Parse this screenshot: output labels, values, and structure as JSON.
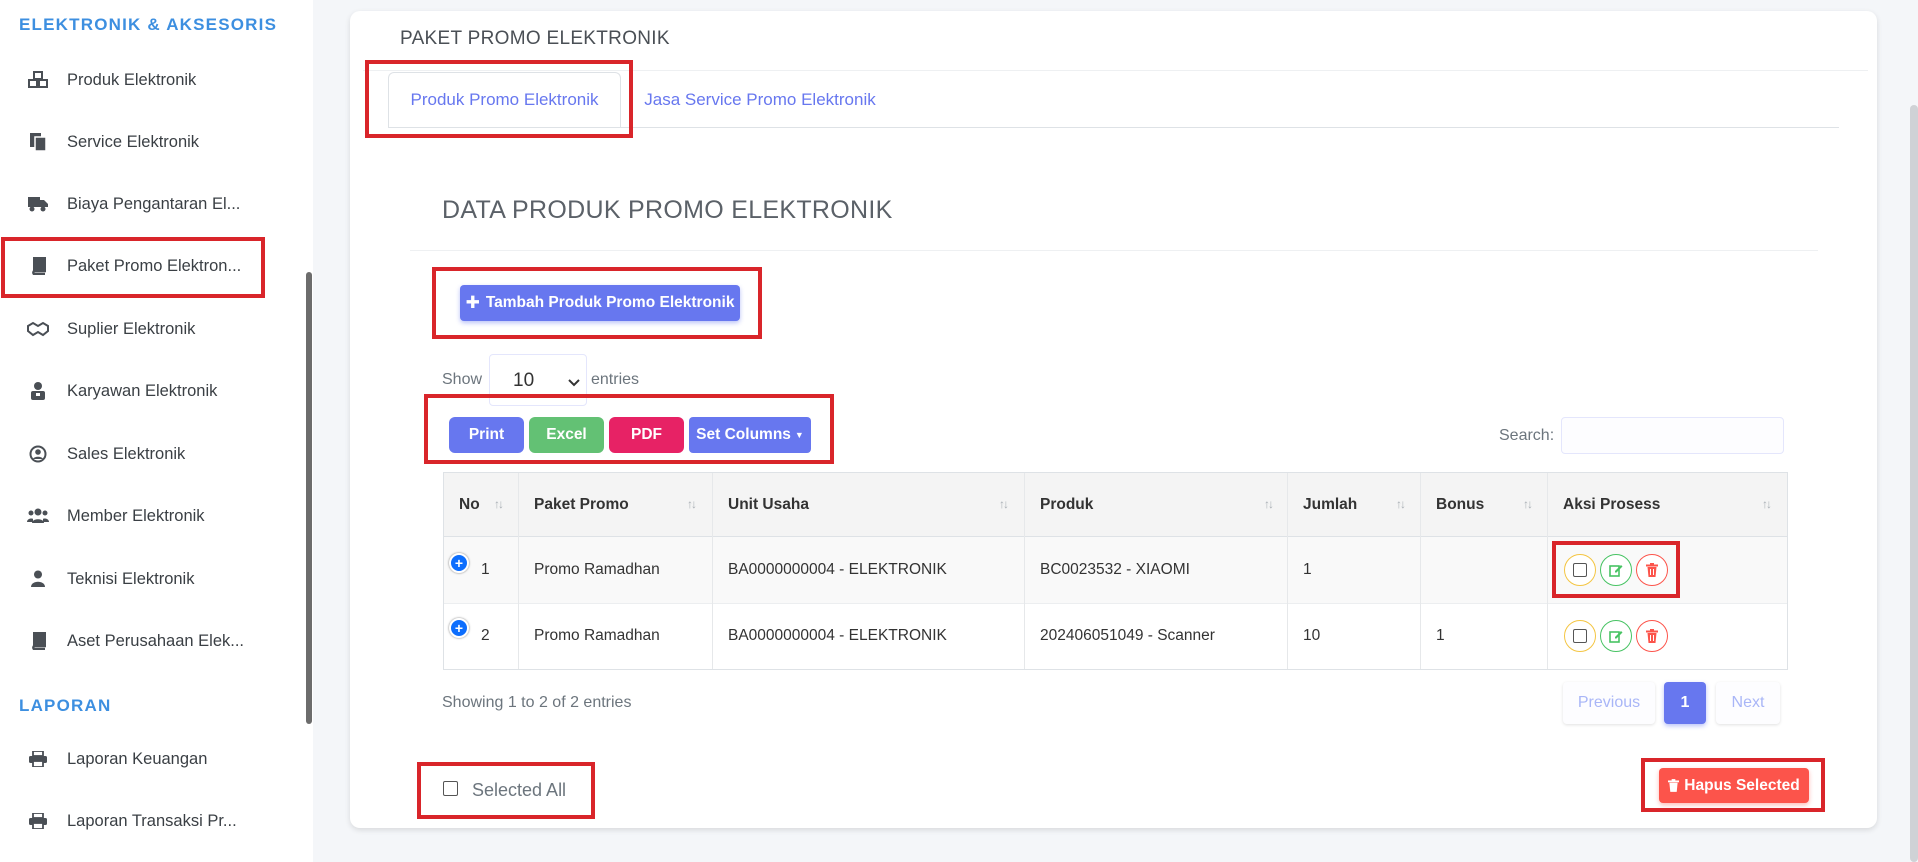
{
  "sidebar": {
    "section_electronics": "ELEKTRONIK & AKSESORIS",
    "items": [
      {
        "label": "Produk Elektronik",
        "icon": "cubes-icon"
      },
      {
        "label": "Service Elektronik",
        "icon": "copy-icon"
      },
      {
        "label": "Biaya Pengantaran El...",
        "icon": "truck-icon"
      },
      {
        "label": "Paket Promo Elektron...",
        "icon": "book-icon"
      },
      {
        "label": "Suplier Elektronik",
        "icon": "handshake-icon"
      },
      {
        "label": "Karyawan Elektronik",
        "icon": "briefcase-user-icon"
      },
      {
        "label": "Sales Elektronik",
        "icon": "user-circle-icon"
      },
      {
        "label": "Member Elektronik",
        "icon": "users-icon"
      },
      {
        "label": "Teknisi Elektronik",
        "icon": "user-icon"
      },
      {
        "label": "Aset Perusahaan Elek...",
        "icon": "book-icon"
      }
    ],
    "section_reports": "LAPORAN",
    "report_items": [
      {
        "label": "Laporan Keuangan",
        "icon": "print-icon"
      },
      {
        "label": "Laporan Transaksi Pr...",
        "icon": "print-icon"
      }
    ]
  },
  "card": {
    "title": "PAKET PROMO ELEKTRONIK",
    "tabs": [
      {
        "label": "Produk Promo Elektronik",
        "active": true
      },
      {
        "label": "Jasa Service Promo Elektronik",
        "active": false
      }
    ],
    "data_title": "DATA PRODUK PROMO ELEKTRONIK",
    "add_button": "Tambah Produk Promo Elektronik",
    "show_label": "Show",
    "entries_value": "10",
    "entries_label": "entries",
    "export_buttons": {
      "print": "Print",
      "excel": "Excel",
      "pdf": "PDF",
      "columns": "Set Columns"
    },
    "search_label": "Search:",
    "search_value": ""
  },
  "table": {
    "columns": [
      "No",
      "Paket Promo",
      "Unit Usaha",
      "Produk",
      "Jumlah",
      "Bonus",
      "Aksi Prosess"
    ],
    "rows": [
      {
        "no": "1",
        "paket": "Promo Ramadhan",
        "unit": "BA0000000004 - ELEKTRONIK",
        "produk": "BC0023532 - XIAOMI",
        "jumlah": "1",
        "bonus": ""
      },
      {
        "no": "2",
        "paket": "Promo Ramadhan",
        "unit": "BA0000000004 - ELEKTRONIK",
        "produk": "202406051049 - Scanner",
        "jumlah": "10",
        "bonus": "1"
      }
    ],
    "info": "Showing 1 to 2 of 2 entries",
    "pagination": {
      "previous": "Previous",
      "current": "1",
      "next": "Next"
    }
  },
  "footer": {
    "selected_all": "Selected All",
    "delete_selected": "Hapus Selected"
  },
  "colors": {
    "primary": "#6777ef",
    "success": "#63c174",
    "danger": "#fc544b",
    "pdf": "#e72265",
    "section": "#3d8fe0",
    "highlight": "#d9252a"
  }
}
